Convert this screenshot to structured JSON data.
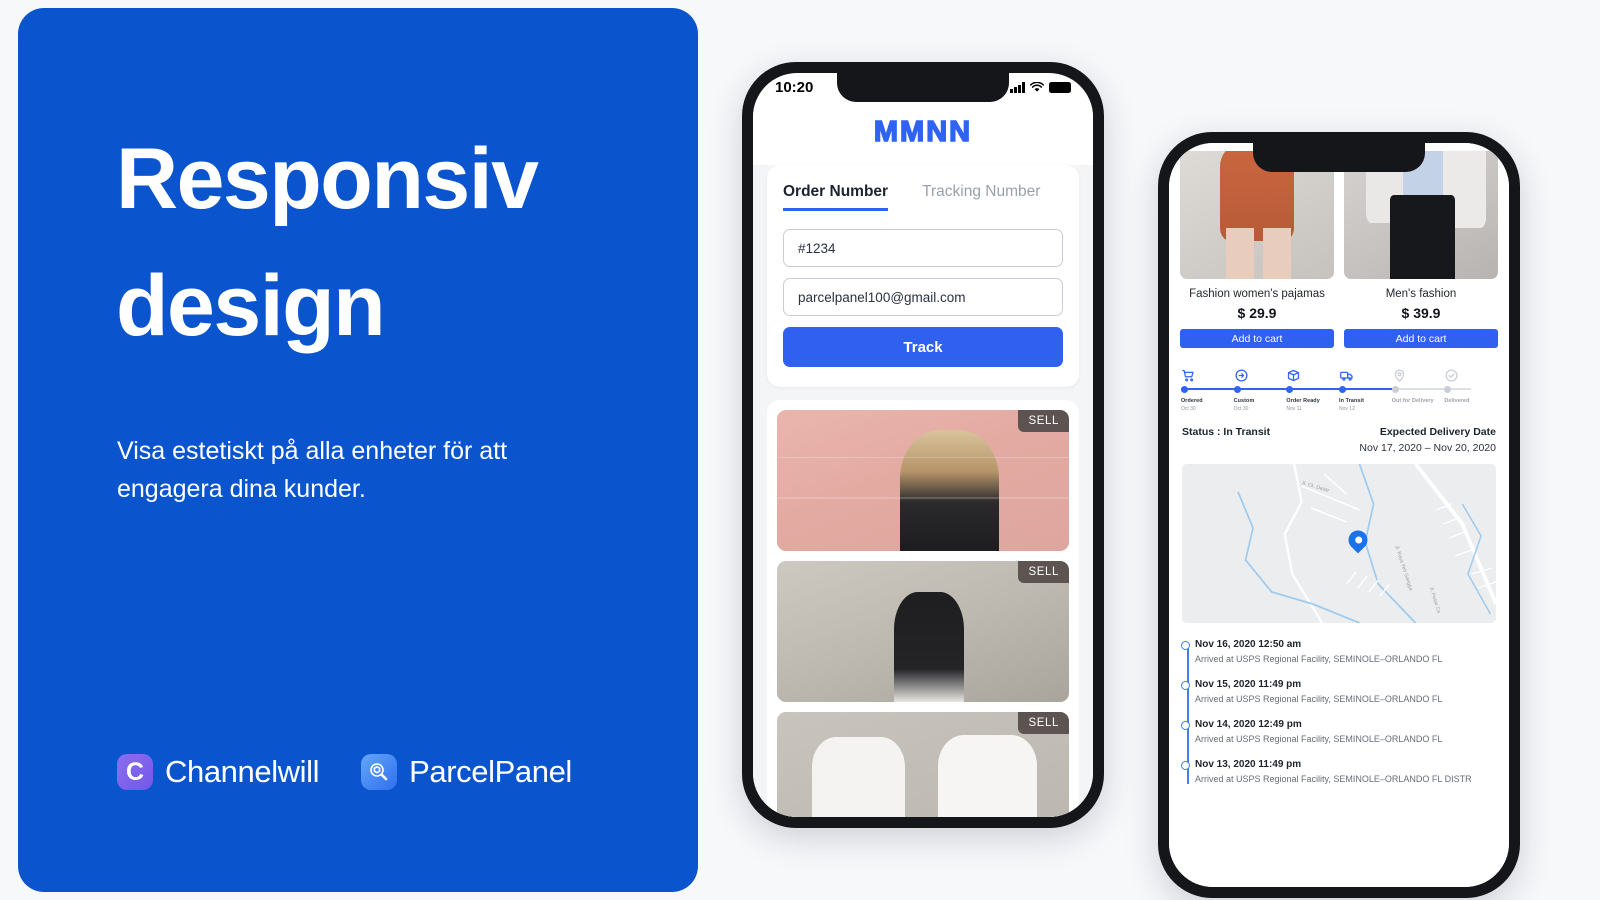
{
  "hero": {
    "title": "Responsiv design",
    "subtitle": "Visa estetiskt på alla enheter för att engagera dina kunder.",
    "background_color": "#0a55ce",
    "logos": [
      {
        "badge": "C",
        "name": "Channelwill",
        "icon": "channelwill-c-icon"
      },
      {
        "badge": "",
        "name": "ParcelPanel",
        "icon": "magnifier-box-icon"
      }
    ]
  },
  "phone_one": {
    "status_bar": {
      "time": "10:20",
      "icons": [
        "signal-icon",
        "wifi-icon",
        "battery-icon"
      ]
    },
    "brand_logo": "MMNN",
    "tracking_form": {
      "tabs": [
        {
          "label": "Order Number",
          "active": true
        },
        {
          "label": "Tracking Number",
          "active": false
        }
      ],
      "order_number_value": "#1234",
      "email_value": "parcelpanel100@gmail.com",
      "submit_label": "Track"
    },
    "products": [
      {
        "badge": "SELL",
        "alt": "woman in black tee against pink brick wall"
      },
      {
        "badge": "SELL",
        "alt": "man in black tee against concrete wall"
      },
      {
        "badge": "SELL",
        "alt": "two people in white force majeure tees"
      }
    ]
  },
  "phone_two": {
    "products": [
      {
        "name": "Fashion women's pajamas",
        "price": "$ 29.9",
        "button": "Add to cart"
      },
      {
        "name": "Men's fashion",
        "price": "$ 39.9",
        "button": "Add to cart"
      }
    ],
    "steps": [
      {
        "label": "Ordered",
        "date": "Oct 30",
        "icon": "cart-icon",
        "active": true
      },
      {
        "label": "Custom",
        "date": "Oct 30",
        "icon": "arrow-circle-icon",
        "active": true
      },
      {
        "label": "Order Ready",
        "date": "Nov 11",
        "icon": "box-icon",
        "active": true
      },
      {
        "label": "In Transit",
        "date": "Nov 12",
        "icon": "truck-icon",
        "active": true
      },
      {
        "label": "Out for Delivery",
        "date": "",
        "icon": "pin-icon",
        "active": false
      },
      {
        "label": "Delivered",
        "date": "",
        "icon": "check-circle-icon",
        "active": false
      }
    ],
    "status": "Status : In Transit",
    "expected_delivery_title": "Expected Delivery Date",
    "expected_delivery_range": "Nov 17, 2020 – Nov 20, 2020",
    "map": {
      "pin": "location-pin-icon",
      "street_labels": [
        "Jl. Ck. Dasar",
        "Jl. Raya Yeh Gangga",
        "Jl. Pasar Ca"
      ]
    },
    "timeline": [
      {
        "time": "Nov 16, 2020 12:50 am",
        "desc": "Arrived at USPS Regional Facility, SEMINOLE–ORLANDO FL"
      },
      {
        "time": "Nov 15, 2020 11:49 pm",
        "desc": "Arrived at USPS Regional Facility, SEMINOLE–ORLANDO FL"
      },
      {
        "time": "Nov 14, 2020 12:49 pm",
        "desc": "Arrived at USPS Regional Facility, SEMINOLE–ORLANDO FL"
      },
      {
        "time": "Nov 13, 2020 11:49 pm",
        "desc": "Arrived at USPS Regional Facility, SEMINOLE–ORLANDO FL DISTR"
      }
    ]
  }
}
